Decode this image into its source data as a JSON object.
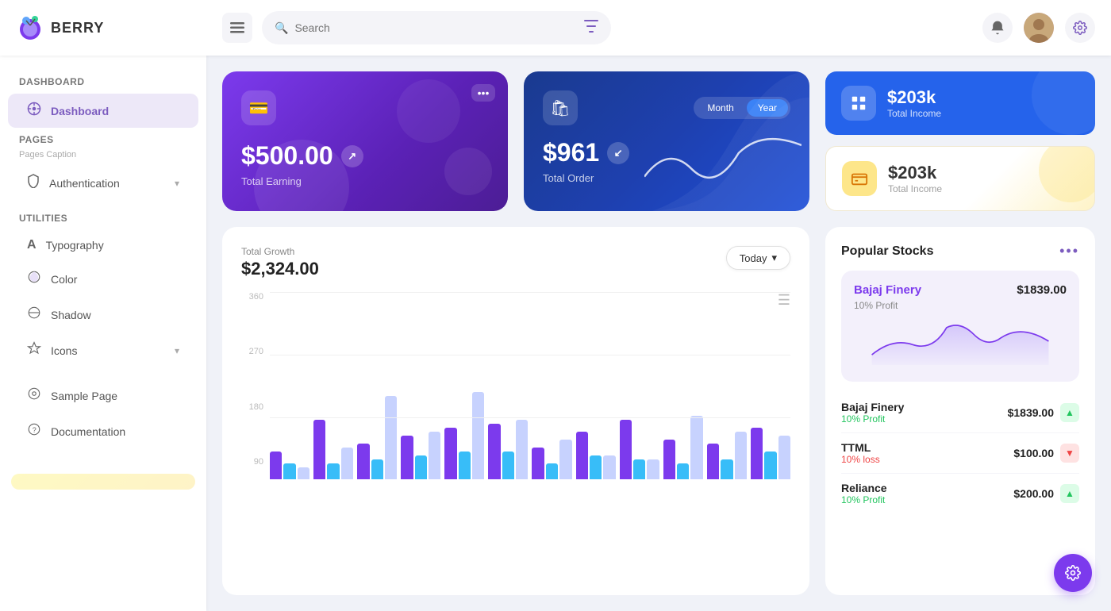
{
  "app": {
    "name": "BERRY",
    "logo_emoji": "🫐"
  },
  "header": {
    "search_placeholder": "Search",
    "menu_label": "☰",
    "notif_icon": "🔔",
    "settings_icon": "⚙️",
    "filter_icon": "⊞"
  },
  "sidebar": {
    "sections": [
      {
        "title": "Dashboard",
        "items": [
          {
            "label": "Dashboard",
            "icon": "⊙",
            "active": true,
            "chevron": false
          }
        ]
      },
      {
        "title": "Pages",
        "caption": "Pages Caption",
        "items": [
          {
            "label": "Authentication",
            "icon": "⊕",
            "active": false,
            "chevron": true
          }
        ]
      },
      {
        "title": "Utilities",
        "items": [
          {
            "label": "Typography",
            "icon": "A",
            "active": false,
            "chevron": false
          },
          {
            "label": "Color",
            "icon": "◎",
            "active": false,
            "chevron": false
          },
          {
            "label": "Shadow",
            "icon": "⊗",
            "active": false,
            "chevron": false
          },
          {
            "label": "Icons",
            "icon": "✦",
            "active": false,
            "chevron": true
          }
        ]
      },
      {
        "title": "",
        "items": [
          {
            "label": "Sample Page",
            "icon": "◎",
            "active": false,
            "chevron": false
          },
          {
            "label": "Documentation",
            "icon": "?",
            "active": false,
            "chevron": false
          }
        ]
      }
    ]
  },
  "cards": {
    "earning": {
      "amount": "$500.00",
      "label": "Total Earning",
      "icon": "💳",
      "trend": "↗"
    },
    "order": {
      "amount": "$961",
      "label": "Total Order",
      "icon": "🛍",
      "trend": "↙",
      "toggle_month": "Month",
      "toggle_year": "Year"
    },
    "income1": {
      "amount": "$203k",
      "label": "Total Income",
      "icon": "📊"
    },
    "income2": {
      "amount": "$203k",
      "label": "Total Income",
      "icon": "🏧"
    }
  },
  "chart": {
    "title": "Total Growth",
    "amount": "$2,324.00",
    "filter": "Today",
    "y_labels": [
      "360",
      "270",
      "180",
      "90"
    ],
    "bars": [
      {
        "purple": 35,
        "teal": 20,
        "light": 15
      },
      {
        "purple": 75,
        "teal": 20,
        "light": 40
      },
      {
        "purple": 45,
        "teal": 25,
        "light": 90
      },
      {
        "purple": 55,
        "teal": 30,
        "light": 60
      },
      {
        "purple": 65,
        "teal": 35,
        "light": 105
      },
      {
        "purple": 70,
        "teal": 35,
        "light": 75
      },
      {
        "purple": 40,
        "teal": 20,
        "light": 50
      },
      {
        "purple": 60,
        "teal": 30,
        "light": 30
      },
      {
        "purple": 75,
        "teal": 25,
        "light": 25
      },
      {
        "purple": 50,
        "teal": 20,
        "light": 80
      },
      {
        "purple": 45,
        "teal": 25,
        "light": 60
      },
      {
        "purple": 65,
        "teal": 35,
        "light": 55
      }
    ]
  },
  "stocks": {
    "title": "Popular Stocks",
    "featured": {
      "name": "Bajaj Finery",
      "price": "$1839.00",
      "profit_label": "10% Profit"
    },
    "list": [
      {
        "name": "Bajaj Finery",
        "profit": "10% Profit",
        "profit_type": "positive",
        "price": "$1839.00",
        "trend": "up"
      },
      {
        "name": "TTML",
        "profit": "10% loss",
        "profit_type": "negative",
        "price": "$100.00",
        "trend": "down"
      },
      {
        "name": "Reliance",
        "profit": "10% Profit",
        "profit_type": "positive",
        "price": "$200.00",
        "trend": "up"
      }
    ]
  }
}
